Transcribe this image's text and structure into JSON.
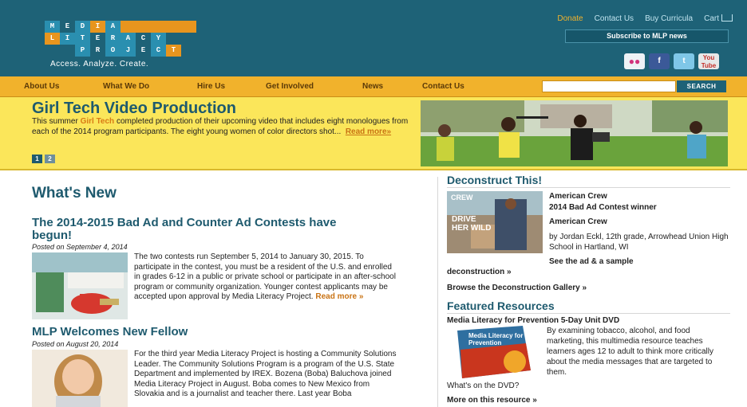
{
  "header": {
    "logo_rows": [
      [
        "M",
        "E",
        "D",
        "I",
        "A"
      ],
      [
        "L",
        "I",
        "T",
        "E",
        "R",
        "A",
        "C",
        "Y"
      ],
      [
        "P",
        "R",
        "O",
        "J",
        "E",
        "C",
        "T"
      ]
    ],
    "tagline": "Access. Analyze. Create.",
    "top_links": [
      "Donate",
      "Contact Us",
      "Buy Curricula",
      "Cart"
    ],
    "subscribe_label": "Subscribe to MLP news",
    "social": [
      {
        "icon": "flickr-icon",
        "glyph": "●●"
      },
      {
        "icon": "facebook-icon",
        "glyph": "f"
      },
      {
        "icon": "twitter-icon",
        "glyph": "t"
      },
      {
        "icon": "youtube-icon",
        "glyph": "You Tube"
      }
    ]
  },
  "nav": {
    "items": [
      "About Us",
      "What We Do",
      "Hire Us",
      "Get Involved",
      "News",
      "Contact Us"
    ],
    "search_placeholder": "",
    "search_button": "SEARCH"
  },
  "feature": {
    "title": "Girl Tech Video Production",
    "body_pre": "This summer ",
    "body_highlight": "Girl Tech",
    "body_post": " completed production of their upcoming video that includes eight monologues from each of the 2014 program participants. The eight young women of color directors shot...",
    "read_more": "Read more»",
    "pages": [
      "1",
      "2"
    ]
  },
  "main": {
    "heading": "What's New",
    "articles": [
      {
        "title": "The 2014-2015 Bad Ad and Counter Ad Contests have begun!",
        "posted": "Posted on September 4, 2014",
        "text": "The two contests run September 5, 2014 to January 30, 2015. To participate in the contest, you must be a resident of the U.S. and enrolled in grades 6-12 in a public or private school or participate in an after-school program or community organization. Younger contest applicants may be accepted upon approval by Media Literacy Project.",
        "read_more": "Read more »"
      },
      {
        "title": "MLP Welcomes New Fellow",
        "posted": "Posted on August 20, 2014",
        "text": "For the third year Media Literacy Project is hosting a Community Solutions Leader. The Community Solutions Program is a program of the U.S. State Department and implemented by IREX. Bozena (Boba) Baluchova joined Media Literacy Project in August. Boba comes to New Mexico from Slovakia and is a journalist and teacher there. Last year Boba"
      }
    ]
  },
  "sidebar": {
    "deconstruct": {
      "heading": "Deconstruct This!",
      "ad_title": "American Crew",
      "ad_subtitle": "2014 Bad Ad Contest winner",
      "ad_name": "American Crew",
      "ad_by": "by Jordan Eckl, 12th grade, Arrowhead Union High School in Hartland, WI",
      "see_link": "See the ad & a sample",
      "see_link_cont": "deconstruction »",
      "gallery_link": "Browse the Deconstruction Gallery »",
      "poster_brand": "CREW",
      "poster_slogan": "DRIVE HER WILD"
    },
    "resources": {
      "heading": "Featured Resources",
      "item_title": "Media Literacy for Prevention 5-Day Unit DVD",
      "item_text": "By examining tobacco, alcohol, and food marketing, this multimedia resource teaches learners ages 12 to adult to think more critically about the media messages that are targeted to them.",
      "dvd_label": "Media Literacy for Prevention",
      "whats_on": "What's on the DVD?",
      "more_link": "More on this resource »"
    }
  },
  "colors": {
    "header_bg": "#1e6277",
    "nav_bg": "#f1b22c",
    "feature_bg": "#fbe65a",
    "accent_orange": "#d97a15",
    "heading_teal": "#1e5a6e"
  }
}
